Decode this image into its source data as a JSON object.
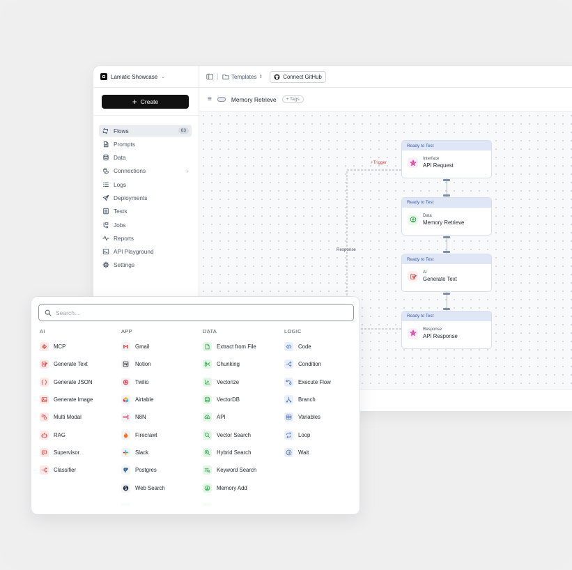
{
  "workspace": {
    "name": "Lamatic Showcase"
  },
  "sidebar": {
    "create_label": "Create",
    "items": [
      {
        "label": "Flows",
        "icon": "flows-icon",
        "badge": "63",
        "active": true
      },
      {
        "label": "Prompts",
        "icon": "document-icon"
      },
      {
        "label": "Data",
        "icon": "database-icon"
      },
      {
        "label": "Connections",
        "icon": "plug-icon",
        "chevron": true
      },
      {
        "label": "Logs",
        "icon": "list-icon"
      },
      {
        "label": "Deployments",
        "icon": "send-icon"
      },
      {
        "label": "Tests",
        "icon": "checklist-icon"
      },
      {
        "label": "Jobs",
        "icon": "jobs-icon"
      },
      {
        "label": "Reports",
        "icon": "activity-icon"
      },
      {
        "label": "API Playground",
        "icon": "terminal-icon"
      },
      {
        "label": "Settings",
        "icon": "gear-icon"
      }
    ]
  },
  "topbar": {
    "templates_label": "Templates",
    "github_label": "Connect GitHub"
  },
  "flow": {
    "title": "Memory Retrieve",
    "tags_label": "+ Tags"
  },
  "canvas": {
    "trigger_label": "+Trigger",
    "response_label": "Response",
    "nodes": [
      {
        "status": "Ready to Test",
        "type": "Interface",
        "name": "API Request",
        "icon": "interface-icon",
        "color": "#d6309a"
      },
      {
        "status": "Ready to Test",
        "type": "Data",
        "name": "Memory Retrieve",
        "icon": "memory-icon",
        "color": "#2aa245"
      },
      {
        "status": "Ready to Test",
        "type": "AI",
        "name": "Generate Text",
        "icon": "generate-text-icon",
        "color": "#e04848"
      },
      {
        "status": "Ready to Test",
        "type": "Response",
        "name": "API Response",
        "icon": "response-icon",
        "color": "#d6309a"
      }
    ]
  },
  "panel": {
    "search_placeholder": "Search...",
    "columns": [
      {
        "key": "ai",
        "title": "AI",
        "items": [
          {
            "label": "MCP",
            "icon": "mcp-icon"
          },
          {
            "label": "Generate Text",
            "icon": "generate-text-icon"
          },
          {
            "label": "Generate JSON",
            "icon": "braces-icon"
          },
          {
            "label": "Generate Image",
            "icon": "image-icon"
          },
          {
            "label": "Multi Modal",
            "icon": "multi-modal-icon"
          },
          {
            "label": "RAG",
            "icon": "robot-icon"
          },
          {
            "label": "Supervisor",
            "icon": "supervisor-icon"
          },
          {
            "label": "Classifier",
            "icon": "branch-split-icon"
          }
        ]
      },
      {
        "key": "app",
        "title": "APP",
        "items": [
          {
            "label": "Gmail",
            "icon": "gmail-icon"
          },
          {
            "label": "Notion",
            "icon": "notion-icon"
          },
          {
            "label": "Twilio",
            "icon": "twilio-icon"
          },
          {
            "label": "Airtable",
            "icon": "airtable-icon"
          },
          {
            "label": "N8N",
            "icon": "n8n-icon"
          },
          {
            "label": "Firecrawl",
            "icon": "fire-icon"
          },
          {
            "label": "Slack",
            "icon": "slack-icon"
          },
          {
            "label": "Postgres",
            "icon": "postgres-icon"
          },
          {
            "label": "Web Search",
            "icon": "web-search-icon"
          }
        ]
      },
      {
        "key": "data",
        "title": "DATA",
        "items": [
          {
            "label": "Extract from File",
            "icon": "file-icon"
          },
          {
            "label": "Chunking",
            "icon": "scissors-icon"
          },
          {
            "label": "Vectorize",
            "icon": "vectorize-icon"
          },
          {
            "label": "VectorDB",
            "icon": "database-icon"
          },
          {
            "label": "API",
            "icon": "cloud-icon"
          },
          {
            "label": "Vector Search",
            "icon": "search-icon"
          },
          {
            "label": "Hybrid Search",
            "icon": "zoom-icon"
          },
          {
            "label": "Keyword Search",
            "icon": "keyword-icon"
          },
          {
            "label": "Memory Add",
            "icon": "memory-icon"
          }
        ]
      },
      {
        "key": "logic",
        "title": "LOGIC",
        "items": [
          {
            "label": "Code",
            "icon": "code-icon"
          },
          {
            "label": "Condition",
            "icon": "branch-split-icon"
          },
          {
            "label": "Execute Flow",
            "icon": "execute-flow-icon"
          },
          {
            "label": "Branch",
            "icon": "branch-icon"
          },
          {
            "label": "Variables",
            "icon": "table-icon"
          },
          {
            "label": "Loop",
            "icon": "loop-icon"
          },
          {
            "label": "Wait",
            "icon": "pause-icon"
          }
        ]
      }
    ]
  }
}
